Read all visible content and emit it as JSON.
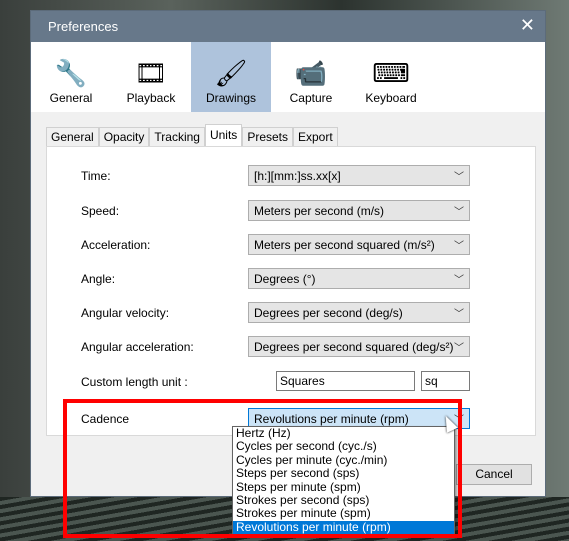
{
  "window": {
    "title": "Preferences"
  },
  "categories": [
    {
      "label": "General",
      "icon": "wrench-screwdriver-icon"
    },
    {
      "label": "Playback",
      "icon": "film-reel-icon"
    },
    {
      "label": "Drawings",
      "icon": "brushes-cup-icon",
      "selected": true
    },
    {
      "label": "Capture",
      "icon": "camcorder-icon"
    },
    {
      "label": "Keyboard",
      "icon": "keyboard-keys-icon"
    }
  ],
  "tabs": [
    {
      "label": "General"
    },
    {
      "label": "Opacity"
    },
    {
      "label": "Tracking"
    },
    {
      "label": "Units",
      "selected": true
    },
    {
      "label": "Presets"
    },
    {
      "label": "Export"
    }
  ],
  "fields": {
    "time": {
      "label": "Time:",
      "value": "[h:][mm:]ss.xx[x]"
    },
    "speed": {
      "label": "Speed:",
      "value": "Meters per second (m/s)"
    },
    "acceleration": {
      "label": "Acceleration:",
      "value": "Meters per second squared (m/s²)"
    },
    "angle": {
      "label": "Angle:",
      "value": "Degrees (°)"
    },
    "angular_velocity": {
      "label": "Angular velocity:",
      "value": "Degrees per second (deg/s)"
    },
    "angular_acceleration": {
      "label": "Angular acceleration:",
      "value": "Degrees per second squared (deg/s²)"
    },
    "custom_length": {
      "label": "Custom length unit :",
      "name": "Squares",
      "abbr": "sq"
    },
    "cadence": {
      "label": "Cadence",
      "value": "Revolutions per minute (rpm)"
    }
  },
  "cadence_options": [
    "Hertz (Hz)",
    "Cycles per second (cyc./s)",
    "Cycles per minute (cyc./min)",
    "Steps per second (sps)",
    "Steps per minute (spm)",
    "Strokes per second (sps)",
    "Strokes per minute (spm)",
    "Revolutions per minute (rpm)"
  ],
  "buttons": {
    "cancel": "Cancel"
  },
  "colors": {
    "titlebar": "#67788a",
    "selected_category": "#aec3dc",
    "highlight": "#0078d7",
    "annotation": "#ff0000"
  }
}
